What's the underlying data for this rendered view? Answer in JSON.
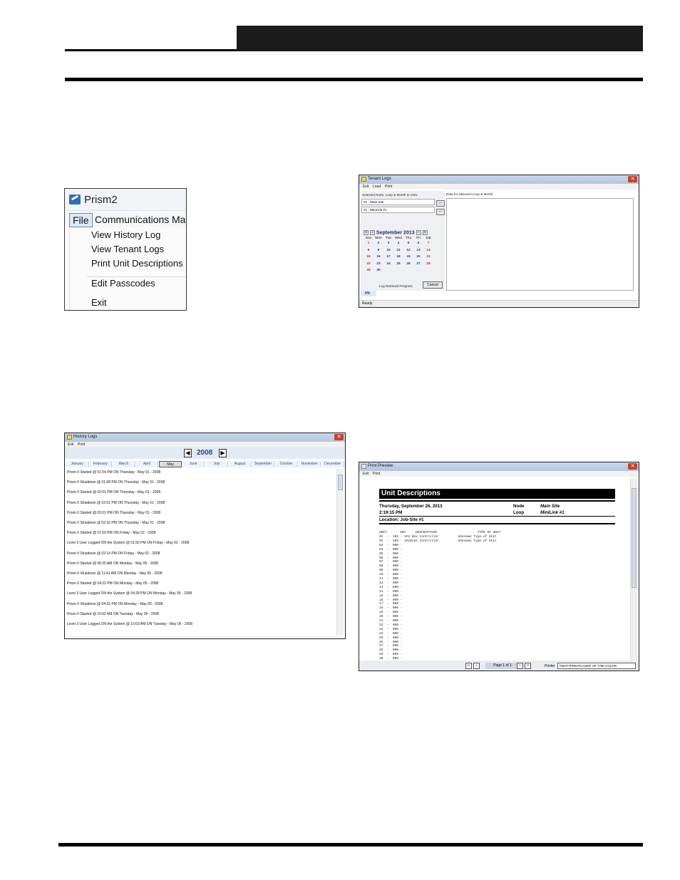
{
  "file_menu": {
    "app_title": "Prism2",
    "menubar": [
      "File",
      "Communications",
      "Mai"
    ],
    "items": [
      "View History Log",
      "View Tenant Logs",
      "Print Unit Descriptions",
      "Edit Passcodes",
      "Exit"
    ]
  },
  "tenant_logs": {
    "title": "Tenant Logs",
    "menu": [
      "Exit",
      "Load",
      "Print"
    ],
    "select_label": "Selected Node, Loop & Month to View",
    "node_value": "#1 - Main Site",
    "loop_value": "#1 - MiniLink #1",
    "dots": "...",
    "month": "September",
    "year": "2013",
    "weekdays": [
      "Sun",
      "Mon",
      "Tue",
      "Wed",
      "Thu",
      "Fri",
      "Sat"
    ],
    "days": [
      [
        "1",
        "2",
        "3",
        "4",
        "5",
        "6",
        "7"
      ],
      [
        "8",
        "9",
        "10",
        "11",
        "12",
        "13",
        "14"
      ],
      [
        "15",
        "16",
        "17",
        "18",
        "19",
        "20",
        "21"
      ],
      [
        "22",
        "23",
        "24",
        "25",
        "26",
        "27",
        "28"
      ],
      [
        "29",
        "30",
        "",
        "",
        "",
        "",
        ""
      ]
    ],
    "progress_label": "Log Retrieval Progress",
    "cancel_label": "Cancel",
    "percent": "0%",
    "data_label": "Data for Selected Loop & Month",
    "status": "Ready"
  },
  "history_logs": {
    "title": "History Logs",
    "menu": [
      "Exit",
      "Print"
    ],
    "year": "2008",
    "months": [
      "January",
      "February",
      "March",
      "April",
      "May",
      "June",
      "July",
      "August",
      "September",
      "October",
      "November",
      "December"
    ],
    "selected_month": "May",
    "entries": [
      "Prism II Started  @ 01:54 PM ON Thursday - May 01 - 2008",
      "Prism II Shutdown  @ 01:58 PM ON Thursday - May 01 - 2008",
      "Prism II Started  @ 02:01 PM ON Thursday - May 01 - 2008",
      "Prism II Shutdown  @ 02:01 PM ON Thursday - May 01 - 2008",
      "Prism II Started  @ 02:01 PM ON Thursday - May 01 - 2008",
      "Prism II Shutdown  @ 02:16 PM ON Thursday - May 01 - 2008",
      "Prism II Started  @ 01:50 PM ON Friday - May 02 - 2008",
      "Level 3 User Logged ON the System @ 01:50 PM ON Friday - May 02 - 2008",
      "Prism II Shutdown  @ 02:14 PM ON Friday - May 02 - 2008",
      "Prism II Started  @ 08:20 AM ON Monday - May 05 - 2008",
      "Prism II Shutdown  @ 11:41 AM ON Monday - May 05 - 2008",
      "Prism II Started  @ 04:22 PM ON Monday - May 05 - 2008",
      "Level 3 User Logged ON the System @ 04:28 PM ON Monday - May 05 - 2008",
      "Prism II Shutdown  @ 04:31 PM ON Monday - May 05 - 2008",
      "Prism II Started  @ 10:02 AM ON Tuesday - May 06 - 2008",
      "Level 3 User Logged ON the System @ 10:03 AM ON Tuesday - May 06 - 2008"
    ]
  },
  "print_preview": {
    "title": "Print Preview",
    "menu": [
      "Exit",
      "Print"
    ],
    "heading": "Unit Descriptions",
    "date": "Thursday, September 26, 2013",
    "time": "2:19:15 PM",
    "location": "Location: Job-Site #1",
    "node_label": "Node",
    "node_value": "Main Site",
    "loop_label": "Loop",
    "loop_value": "MiniLink #1",
    "col_unit": "UNIT",
    "col_id": "ID#",
    "col_desc": "DESCRIPTION",
    "col_type": "TYPE OF UNIT",
    "rows": [
      "01  -  103 - VAV Box Controller          Unknown Type of Unit",
      "02  -  103 - VAVZone Controller          Unknown Type of Unit",
      "03  -  000 -",
      "04  -  000 -",
      "05  -  000 -",
      "06  -  000 -",
      "07  -  000 -",
      "08  -  000 -",
      "09  -  000 -",
      "10  -  000 -",
      "11  -  000 -",
      "12  -  000 -",
      "13  -  000 -",
      "14  -  000 -",
      "15  -  000 -",
      "16  -  000 -",
      "17  -  000 -",
      "18  -  000 -",
      "19  -  000 -",
      "20  -  000 -",
      "21  -  000 -",
      "22  -  000 -",
      "23  -  000 -",
      "24  -  000 -",
      "25  -  000 -",
      "26  -  000 -",
      "27  -  000 -",
      "28  -  000 -",
      "29  -  000 -",
      "30  -  000 -"
    ],
    "page": "Page 1 of 1",
    "printer_label": "Printer",
    "printer_value": "\\\\WATTPRINT\\LASER HP 7790 COLOR"
  }
}
